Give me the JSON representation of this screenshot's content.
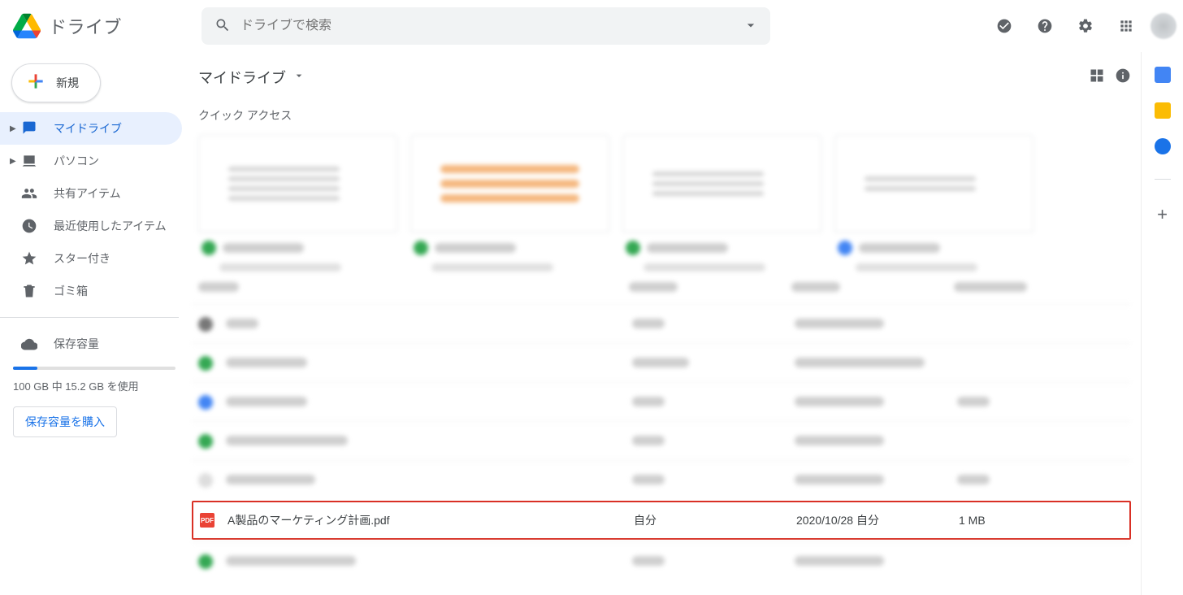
{
  "product": "ドライブ",
  "search": {
    "placeholder": "ドライブで検索"
  },
  "newButton": "新規",
  "nav": {
    "myDrive": "マイドライブ",
    "computers": "パソコン",
    "shared": "共有アイテム",
    "recent": "最近使用したアイテム",
    "starred": "スター付き",
    "trash": "ゴミ箱",
    "storage": "保存容量"
  },
  "storageText": "100 GB 中 15.2 GB を使用",
  "buyStorage": "保存容量を購入",
  "breadcrumb": "マイドライブ",
  "quickAccess": "クイック アクセス",
  "file": {
    "pdfBadge": "PDF",
    "name": "A製品のマーケティング計画.pdf",
    "owner": "自分",
    "date": "2020/10/28 自分",
    "size": "1 MB"
  }
}
